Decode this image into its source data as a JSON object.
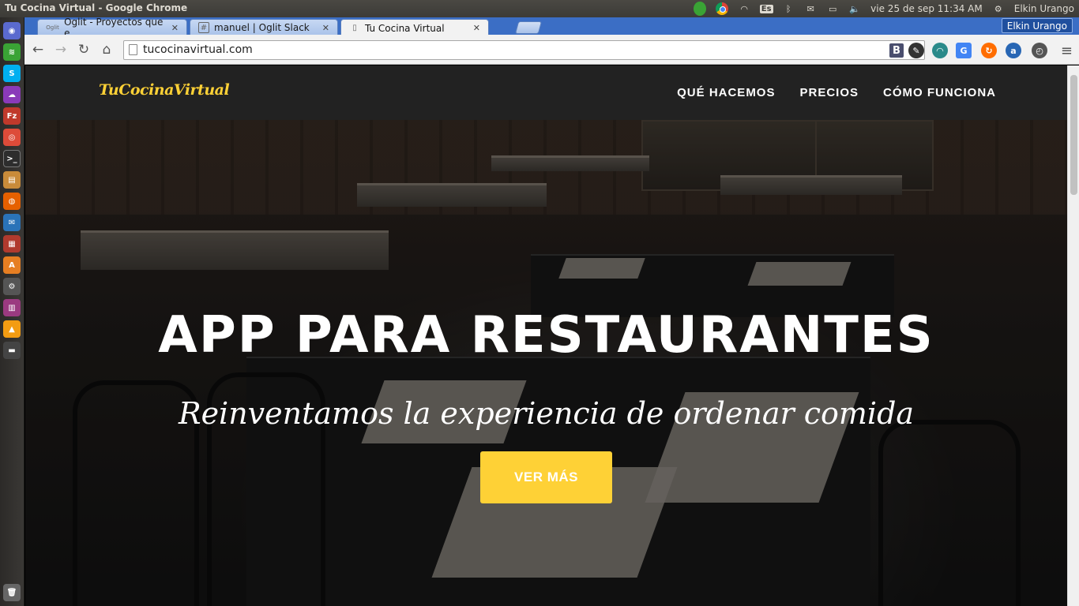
{
  "os": {
    "window_title": "Tu Cocina Virtual - Google Chrome",
    "keyboard_layout": "Es",
    "clock": "vie 25 de sep 11:34 AM",
    "user": "Elkin Urango"
  },
  "browser": {
    "tabs": [
      {
        "label": "Oglit - Proyectos que e",
        "favicon": "Oglit"
      },
      {
        "label": "manuel | Oglit Slack",
        "favicon": "#"
      },
      {
        "label": "Tu Cocina Virtual",
        "favicon": "page"
      }
    ],
    "profile_name": "Elkin Urango",
    "url": "tucocinavirtual.com",
    "extension_b": "B"
  },
  "site": {
    "brand": "TuCocinaVirtual",
    "nav": [
      "QUÉ HACEMOS",
      "PRECIOS",
      "CÓMO FUNCIONA"
    ],
    "hero_title": "APP PARA RESTAURANTES",
    "hero_subtitle": "Reinventamos la experiencia de ordenar comida",
    "cta": "VER MÁS"
  },
  "colors": {
    "accent": "#fed136",
    "nav_bg": "#222222",
    "chrome_frame": "#3b6ec5"
  }
}
